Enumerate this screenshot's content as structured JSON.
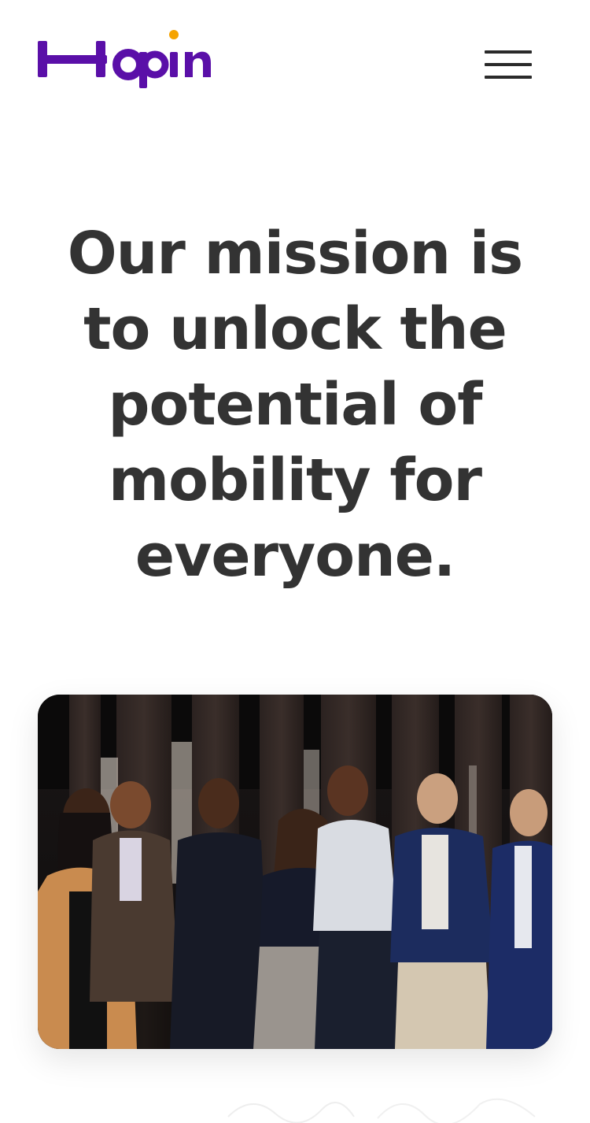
{
  "header": {
    "logo_text": "Hopin",
    "logo_colors": {
      "wordmark": "#5a0fa8",
      "dot": "#f5a300"
    },
    "menu_icon": "hamburger-menu-icon"
  },
  "hero": {
    "title": "Our mission is to unlock the potential of mobility for everyone."
  },
  "team_photo": {
    "icon": "team-group-photo"
  }
}
